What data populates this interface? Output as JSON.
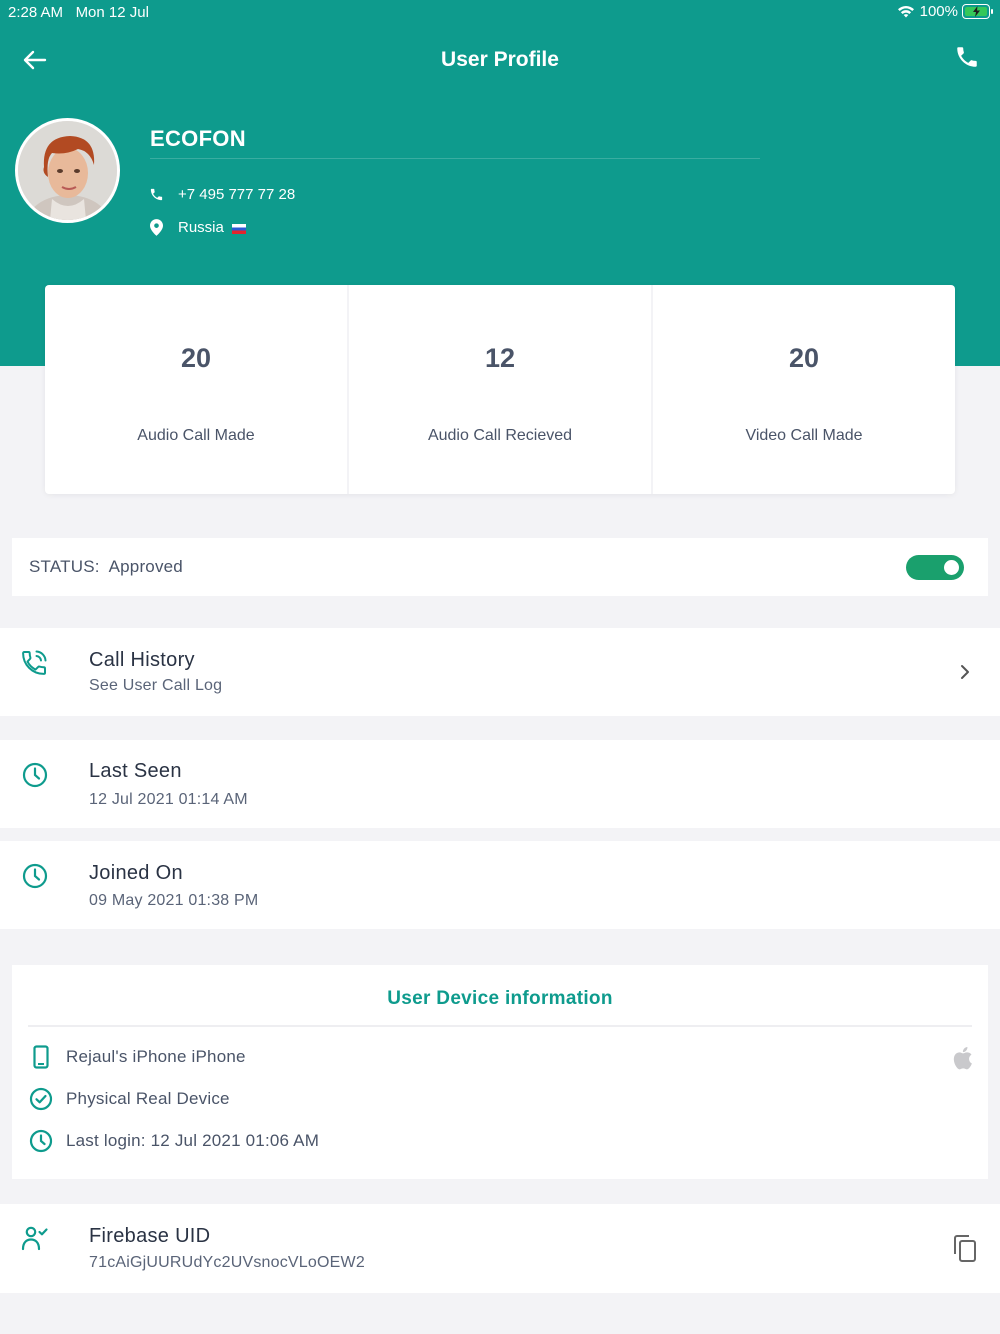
{
  "status_bar": {
    "time": "2:28 AM",
    "date": "Mon 12 Jul",
    "battery": "100%"
  },
  "nav": {
    "title": "User Profile"
  },
  "profile": {
    "name": "ECOFON",
    "phone": "+7 495 777 77 28",
    "country": "Russia"
  },
  "stats": [
    {
      "value": "20",
      "label": "Audio Call Made"
    },
    {
      "value": "12",
      "label": "Audio Call Recieved"
    },
    {
      "value": "20",
      "label": "Video Call Made"
    }
  ],
  "status": {
    "label": "STATUS:",
    "value": "Approved",
    "enabled": true
  },
  "call_history": {
    "title": "Call History",
    "subtitle": "See User Call Log"
  },
  "last_seen": {
    "title": "Last Seen",
    "value": "12 Jul 2021  01:14 AM"
  },
  "joined_on": {
    "title": "Joined On",
    "value": "09 May 2021  01:38 PM"
  },
  "device": {
    "title": "User Device information",
    "name": "Rejaul's iPhone iPhone",
    "type": "Physical Real Device",
    "last_login": "Last login: 12 Jul 2021  01:06 AM"
  },
  "firebase": {
    "title": "Firebase UID",
    "value": "71cAiGjUURUdYc2UVsnocVLoOEW2"
  },
  "colors": {
    "primary": "#0e9b8d",
    "toggle": "#1aa06d",
    "background": "#f3f3f6"
  }
}
